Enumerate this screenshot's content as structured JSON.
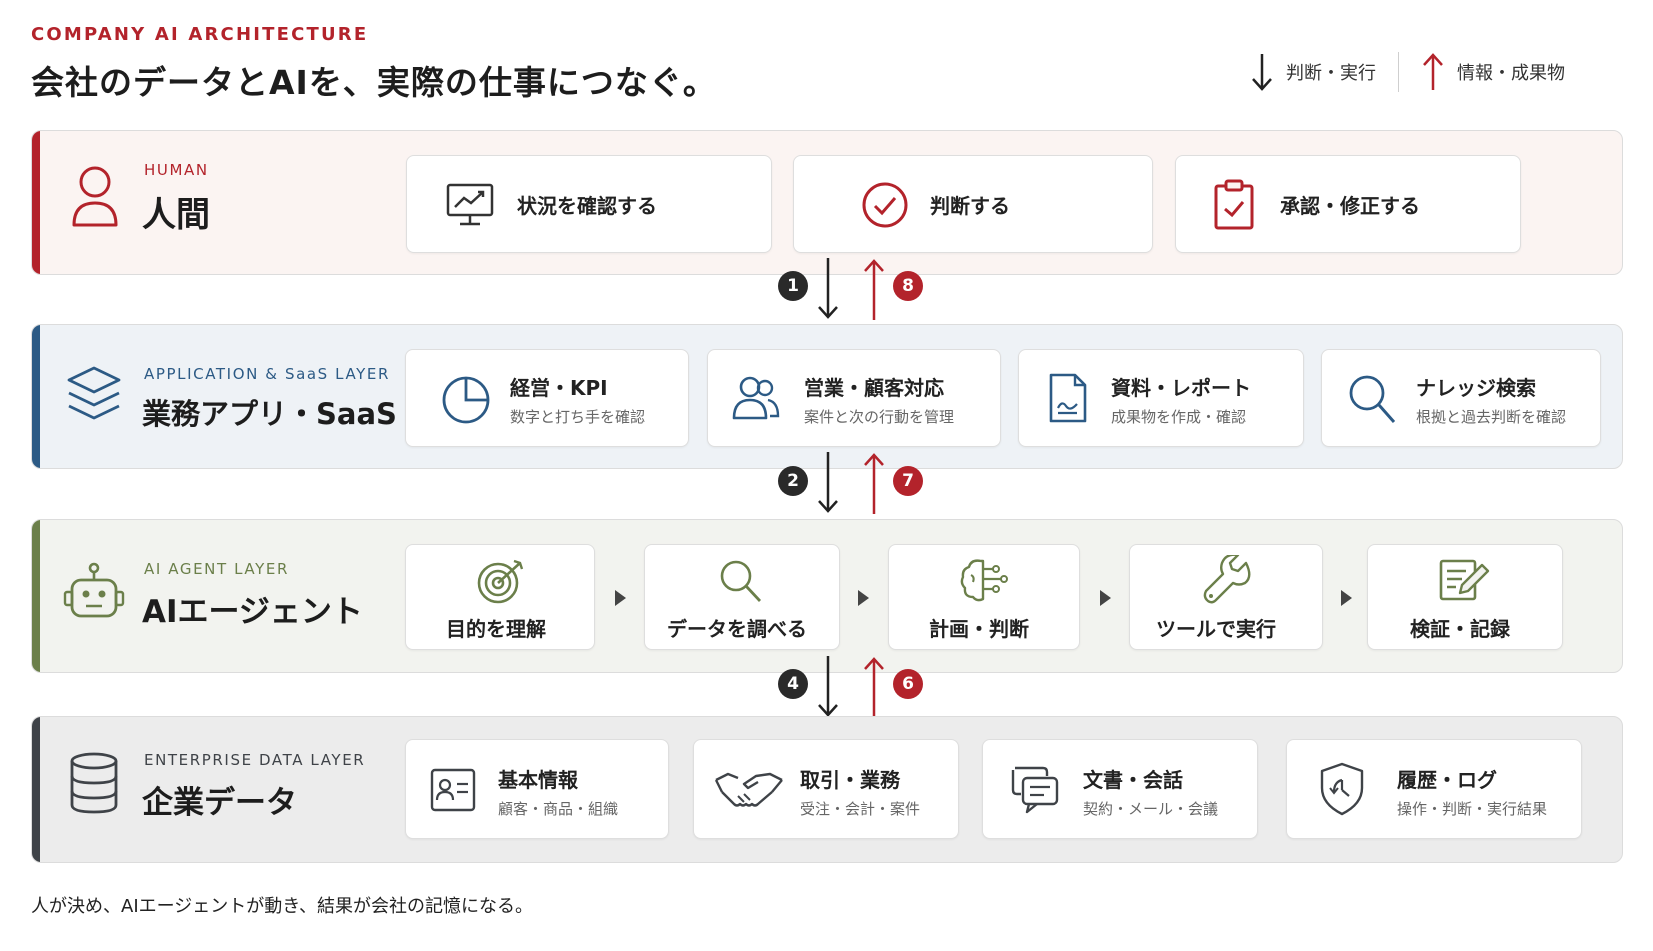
{
  "header": {
    "eyebrow": "COMPANY AI ARCHITECTURE",
    "title": "会社のデータとAIを、実際の仕事につなぐ。"
  },
  "legend": {
    "down_label": "判断・実行",
    "up_label": "情報・成果物"
  },
  "layers": {
    "human": {
      "en": "HUMAN",
      "ja": "人間",
      "accent": "#b3232b",
      "cards": [
        {
          "icon": "monitor-chart-icon",
          "title": "状況を確認する"
        },
        {
          "icon": "check-circle-icon",
          "title": "判断する"
        },
        {
          "icon": "clipboard-check-icon",
          "title": "承認・修正する"
        }
      ]
    },
    "app": {
      "en": "APPLICATION & SaaS LAYER",
      "ja": "業務アプリ・SaaS",
      "accent": "#2c5a85",
      "cards": [
        {
          "icon": "pie-chart-icon",
          "title": "経営・KPI",
          "sub": "数字と打ち手を確認"
        },
        {
          "icon": "users-icon",
          "title": "営業・顧客対応",
          "sub": "案件と次の行動を管理"
        },
        {
          "icon": "document-icon",
          "title": "資料・レポート",
          "sub": "成果物を作成・確認"
        },
        {
          "icon": "search-icon",
          "title": "ナレッジ検索",
          "sub": "根拠と過去判断を確認"
        }
      ]
    },
    "agent": {
      "en": "AI AGENT LAYER",
      "ja": "AIエージェント",
      "accent": "#6b7f4a",
      "steps": [
        {
          "icon": "target-icon",
          "title": "目的を理解"
        },
        {
          "icon": "search-icon",
          "title": "データを調べる"
        },
        {
          "icon": "brain-icon",
          "title": "計画・判断"
        },
        {
          "icon": "wrench-icon",
          "title": "ツールで実行"
        },
        {
          "icon": "edit-note-icon",
          "title": "検証・記録"
        }
      ]
    },
    "data": {
      "en": "ENTERPRISE DATA LAYER",
      "ja": "企業データ",
      "accent": "#3f4348",
      "cards": [
        {
          "icon": "id-card-icon",
          "title": "基本情報",
          "sub": "顧客・商品・組織"
        },
        {
          "icon": "handshake-icon",
          "title": "取引・業務",
          "sub": "受注・会計・案件"
        },
        {
          "icon": "chat-icon",
          "title": "文書・会話",
          "sub": "契約・メール・会議"
        },
        {
          "icon": "shield-clock-icon",
          "title": "履歴・ログ",
          "sub": "操作・判断・実行結果"
        }
      ]
    }
  },
  "flows": {
    "d1": "1",
    "u8": "8",
    "d2": "2",
    "u7": "7",
    "d4": "4",
    "u6": "6"
  },
  "caption": "人が決め、AIエージェントが動き、結果が会社の記憶になる。"
}
